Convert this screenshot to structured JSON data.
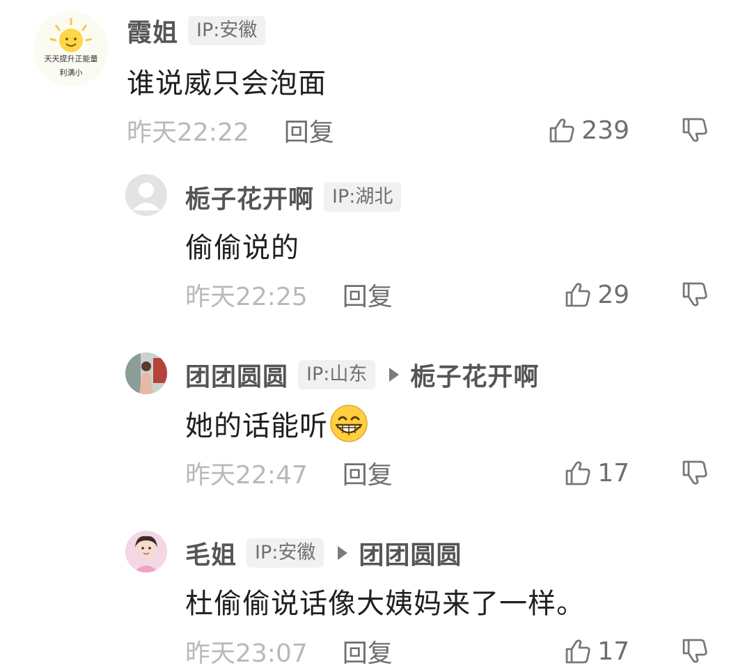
{
  "comments": [
    {
      "username": "霞姐",
      "ip": "IP:安徽",
      "text": "谁说威只会泡面",
      "time": "昨天22:22",
      "reply_label": "回复",
      "likes": "239",
      "avatar_text_1": "天天提升正能量",
      "avatar_text_2": "利满小"
    },
    {
      "username": "栀子花开啊",
      "ip": "IP:湖北",
      "text": "偷偷说的",
      "time": "昨天22:25",
      "reply_label": "回复",
      "likes": "29"
    },
    {
      "username": "团团圆圆",
      "ip": "IP:山东",
      "reply_to": "栀子花开啊",
      "text": "她的话能听",
      "time": "昨天22:47",
      "reply_label": "回复",
      "likes": "17"
    },
    {
      "username": "毛姐",
      "ip": "IP:安徽",
      "reply_to": "团团圆圆",
      "text": "杜偷偷说话像大姨妈来了一样。",
      "time": "昨天23:07",
      "reply_label": "回复",
      "likes": "17"
    }
  ],
  "icons": {
    "like": "thumbs-up-outline",
    "dislike": "thumbs-down-outline",
    "emoji": "grinning-face-with-smiling-eyes",
    "reply_to": "right-triangle"
  },
  "colors": {
    "username": "#555555",
    "text": "#1f1f1f",
    "time": "#b9b9b9",
    "action": "#6e6e6e",
    "ip_badge_bg": "#f1f1f1"
  }
}
